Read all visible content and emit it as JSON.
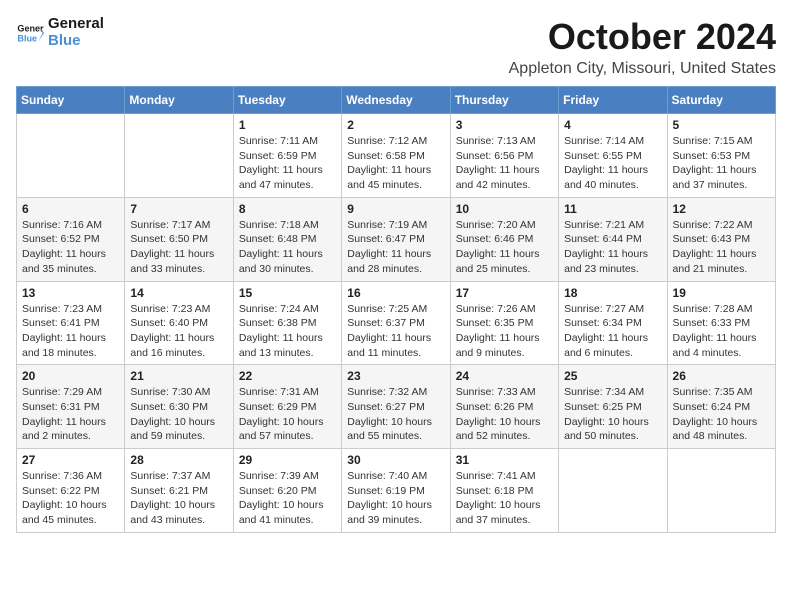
{
  "logo": {
    "line1": "General",
    "line2": "Blue"
  },
  "title": "October 2024",
  "subtitle": "Appleton City, Missouri, United States",
  "days_header": [
    "Sunday",
    "Monday",
    "Tuesday",
    "Wednesday",
    "Thursday",
    "Friday",
    "Saturday"
  ],
  "weeks": [
    [
      {
        "day": "",
        "info": ""
      },
      {
        "day": "",
        "info": ""
      },
      {
        "day": "1",
        "info": "Sunrise: 7:11 AM\nSunset: 6:59 PM\nDaylight: 11 hours and 47 minutes."
      },
      {
        "day": "2",
        "info": "Sunrise: 7:12 AM\nSunset: 6:58 PM\nDaylight: 11 hours and 45 minutes."
      },
      {
        "day": "3",
        "info": "Sunrise: 7:13 AM\nSunset: 6:56 PM\nDaylight: 11 hours and 42 minutes."
      },
      {
        "day": "4",
        "info": "Sunrise: 7:14 AM\nSunset: 6:55 PM\nDaylight: 11 hours and 40 minutes."
      },
      {
        "day": "5",
        "info": "Sunrise: 7:15 AM\nSunset: 6:53 PM\nDaylight: 11 hours and 37 minutes."
      }
    ],
    [
      {
        "day": "6",
        "info": "Sunrise: 7:16 AM\nSunset: 6:52 PM\nDaylight: 11 hours and 35 minutes."
      },
      {
        "day": "7",
        "info": "Sunrise: 7:17 AM\nSunset: 6:50 PM\nDaylight: 11 hours and 33 minutes."
      },
      {
        "day": "8",
        "info": "Sunrise: 7:18 AM\nSunset: 6:48 PM\nDaylight: 11 hours and 30 minutes."
      },
      {
        "day": "9",
        "info": "Sunrise: 7:19 AM\nSunset: 6:47 PM\nDaylight: 11 hours and 28 minutes."
      },
      {
        "day": "10",
        "info": "Sunrise: 7:20 AM\nSunset: 6:46 PM\nDaylight: 11 hours and 25 minutes."
      },
      {
        "day": "11",
        "info": "Sunrise: 7:21 AM\nSunset: 6:44 PM\nDaylight: 11 hours and 23 minutes."
      },
      {
        "day": "12",
        "info": "Sunrise: 7:22 AM\nSunset: 6:43 PM\nDaylight: 11 hours and 21 minutes."
      }
    ],
    [
      {
        "day": "13",
        "info": "Sunrise: 7:23 AM\nSunset: 6:41 PM\nDaylight: 11 hours and 18 minutes."
      },
      {
        "day": "14",
        "info": "Sunrise: 7:23 AM\nSunset: 6:40 PM\nDaylight: 11 hours and 16 minutes."
      },
      {
        "day": "15",
        "info": "Sunrise: 7:24 AM\nSunset: 6:38 PM\nDaylight: 11 hours and 13 minutes."
      },
      {
        "day": "16",
        "info": "Sunrise: 7:25 AM\nSunset: 6:37 PM\nDaylight: 11 hours and 11 minutes."
      },
      {
        "day": "17",
        "info": "Sunrise: 7:26 AM\nSunset: 6:35 PM\nDaylight: 11 hours and 9 minutes."
      },
      {
        "day": "18",
        "info": "Sunrise: 7:27 AM\nSunset: 6:34 PM\nDaylight: 11 hours and 6 minutes."
      },
      {
        "day": "19",
        "info": "Sunrise: 7:28 AM\nSunset: 6:33 PM\nDaylight: 11 hours and 4 minutes."
      }
    ],
    [
      {
        "day": "20",
        "info": "Sunrise: 7:29 AM\nSunset: 6:31 PM\nDaylight: 11 hours and 2 minutes."
      },
      {
        "day": "21",
        "info": "Sunrise: 7:30 AM\nSunset: 6:30 PM\nDaylight: 10 hours and 59 minutes."
      },
      {
        "day": "22",
        "info": "Sunrise: 7:31 AM\nSunset: 6:29 PM\nDaylight: 10 hours and 57 minutes."
      },
      {
        "day": "23",
        "info": "Sunrise: 7:32 AM\nSunset: 6:27 PM\nDaylight: 10 hours and 55 minutes."
      },
      {
        "day": "24",
        "info": "Sunrise: 7:33 AM\nSunset: 6:26 PM\nDaylight: 10 hours and 52 minutes."
      },
      {
        "day": "25",
        "info": "Sunrise: 7:34 AM\nSunset: 6:25 PM\nDaylight: 10 hours and 50 minutes."
      },
      {
        "day": "26",
        "info": "Sunrise: 7:35 AM\nSunset: 6:24 PM\nDaylight: 10 hours and 48 minutes."
      }
    ],
    [
      {
        "day": "27",
        "info": "Sunrise: 7:36 AM\nSunset: 6:22 PM\nDaylight: 10 hours and 45 minutes."
      },
      {
        "day": "28",
        "info": "Sunrise: 7:37 AM\nSunset: 6:21 PM\nDaylight: 10 hours and 43 minutes."
      },
      {
        "day": "29",
        "info": "Sunrise: 7:39 AM\nSunset: 6:20 PM\nDaylight: 10 hours and 41 minutes."
      },
      {
        "day": "30",
        "info": "Sunrise: 7:40 AM\nSunset: 6:19 PM\nDaylight: 10 hours and 39 minutes."
      },
      {
        "day": "31",
        "info": "Sunrise: 7:41 AM\nSunset: 6:18 PM\nDaylight: 10 hours and 37 minutes."
      },
      {
        "day": "",
        "info": ""
      },
      {
        "day": "",
        "info": ""
      }
    ]
  ]
}
